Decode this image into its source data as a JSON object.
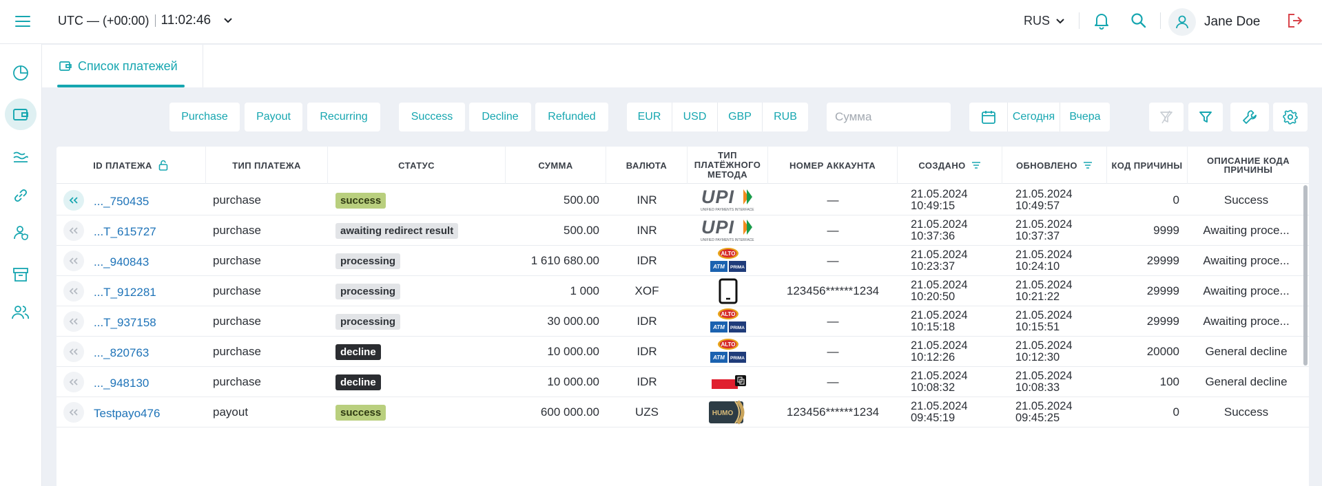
{
  "header": {
    "timezone": "UTC — (+00:00)",
    "time": "11:02:46",
    "language": "RUS",
    "user_name": "Jane Doe"
  },
  "tabs": [
    {
      "label": "Список платежей"
    }
  ],
  "filters": {
    "types": [
      "Purchase",
      "Payout",
      "Recurring"
    ],
    "statuses": [
      "Success",
      "Decline",
      "Refunded"
    ],
    "currencies": [
      "EUR",
      "USD",
      "GBP",
      "RUB"
    ],
    "amount_placeholder": "Сумма",
    "dates": [
      "Сегодня",
      "Вчера"
    ]
  },
  "columns": {
    "id": "ID ПЛАТЕЖА",
    "type": "ТИП ПЛАТЕЖА",
    "status": "СТАТУС",
    "amount": "СУММА",
    "currency": "ВАЛЮТА",
    "method": "ТИП ПЛАТЁЖНОГО МЕТОДА",
    "account": "НОМЕР АККАУНТА",
    "created": "СОЗДАНО",
    "updated": "ОБНОВЛЕНО",
    "reason_code": "КОД ПРИЧИНЫ",
    "reason_desc": "ОПИСАНИЕ КОДА ПРИЧИНЫ"
  },
  "rows": [
    {
      "id": "..._750435",
      "type": "purchase",
      "status": "success",
      "amount": "500.00",
      "currency": "INR",
      "method": "upi",
      "account": "—",
      "created_date": "21.05.2024",
      "created_time": "10:49:15",
      "updated_date": "21.05.2024",
      "updated_time": "10:49:57",
      "code": "0",
      "desc": "Success"
    },
    {
      "id": "...T_615727",
      "type": "purchase",
      "status": "awaiting redirect result",
      "amount": "500.00",
      "currency": "INR",
      "method": "upi",
      "account": "—",
      "created_date": "21.05.2024",
      "created_time": "10:37:36",
      "updated_date": "21.05.2024",
      "updated_time": "10:37:37",
      "code": "9999",
      "desc": "Awaiting proce..."
    },
    {
      "id": "..._940843",
      "type": "purchase",
      "status": "processing",
      "amount": "1 610 680.00",
      "currency": "IDR",
      "method": "alto",
      "account": "—",
      "created_date": "21.05.2024",
      "created_time": "10:23:37",
      "updated_date": "21.05.2024",
      "updated_time": "10:24:10",
      "code": "29999",
      "desc": "Awaiting proce..."
    },
    {
      "id": "...T_912281",
      "type": "purchase",
      "status": "processing",
      "amount": "1 000",
      "currency": "XOF",
      "method": "mobile",
      "account": "123456******1234",
      "created_date": "21.05.2024",
      "created_time": "10:20:50",
      "updated_date": "21.05.2024",
      "updated_time": "10:21:22",
      "code": "29999",
      "desc": "Awaiting proce..."
    },
    {
      "id": "...T_937158",
      "type": "purchase",
      "status": "processing",
      "amount": "30 000.00",
      "currency": "IDR",
      "method": "alto",
      "account": "—",
      "created_date": "21.05.2024",
      "created_time": "10:15:18",
      "updated_date": "21.05.2024",
      "updated_time": "10:15:51",
      "code": "29999",
      "desc": "Awaiting proce..."
    },
    {
      "id": "..._820763",
      "type": "purchase",
      "status": "decline",
      "amount": "10 000.00",
      "currency": "IDR",
      "method": "alto",
      "account": "—",
      "created_date": "21.05.2024",
      "created_time": "10:12:26",
      "updated_date": "21.05.2024",
      "updated_time": "10:12:30",
      "code": "20000",
      "desc": "General decline"
    },
    {
      "id": "..._948130",
      "type": "purchase",
      "status": "decline",
      "amount": "10 000.00",
      "currency": "IDR",
      "method": "redcard",
      "account": "—",
      "created_date": "21.05.2024",
      "created_time": "10:08:32",
      "updated_date": "21.05.2024",
      "updated_time": "10:08:33",
      "code": "100",
      "desc": "General decline"
    },
    {
      "id": "Testpayo476",
      "type": "payout",
      "status": "success",
      "amount": "600 000.00",
      "currency": "UZS",
      "method": "humo",
      "account": "123456******1234",
      "created_date": "21.05.2024",
      "created_time": "09:45:19",
      "updated_date": "21.05.2024",
      "updated_time": "09:45:25",
      "code": "0",
      "desc": "Success"
    }
  ],
  "logos": {
    "upi_text": "UPI",
    "upi_sub": "UNIFIED PAYMENTS INTERFACE",
    "alto_text": "ALTO",
    "atm_text": "ATM",
    "prima_text": "PRIMA",
    "humo_text": "HUMO"
  },
  "colors": {
    "accent": "#16a6b0",
    "link": "#1e73b8",
    "success_badge": "#b9cf7e",
    "decline_badge": "#2b2d31",
    "logout": "#d8434a"
  }
}
